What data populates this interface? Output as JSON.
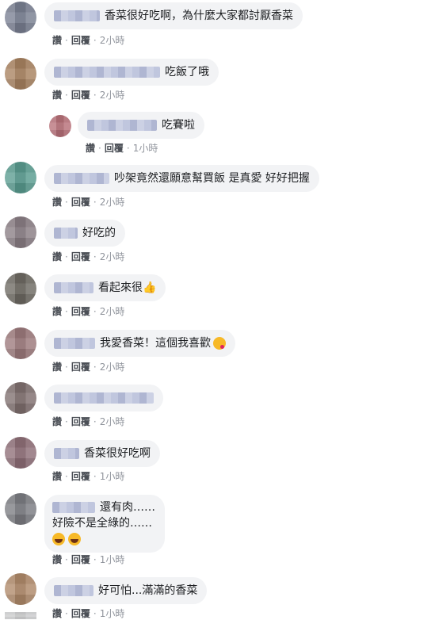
{
  "actions": {
    "like": "讚",
    "reply": "回覆",
    "sep": "·"
  },
  "comments": [
    {
      "text": "香菜很好吃啊，為什麼大家都討厭香菜",
      "time": "2小時"
    },
    {
      "text": "吃飯了哦",
      "time": "2小時"
    },
    {
      "text": "吃賽啦",
      "time": "1小時"
    },
    {
      "text": "吵架竟然還願意幫買飯 是真愛 好好把握",
      "time": "2小時"
    },
    {
      "text": "好吃的",
      "time": "2小時"
    },
    {
      "text": "看起來很",
      "time": "2小時",
      "emoji": "thumbs-up"
    },
    {
      "text": "我愛香菜！這個我喜歡",
      "time": "2小時",
      "emoji": "kiss-face"
    },
    {
      "text": "",
      "time": "2小時"
    },
    {
      "text": "香菜很好吃啊",
      "time": "1小時"
    },
    {
      "line1": "還有肉……",
      "line2": "好險不是全綠的……",
      "time": "1小時",
      "emoji": "laughing-tears"
    },
    {
      "text": "好可怕...滿滿的香菜",
      "time": "1小時"
    }
  ],
  "colors": {
    "bubble": "#f2f3f5",
    "action_text": "#4b4f56",
    "time_text": "#90949c",
    "thumb": "#f7b928"
  }
}
